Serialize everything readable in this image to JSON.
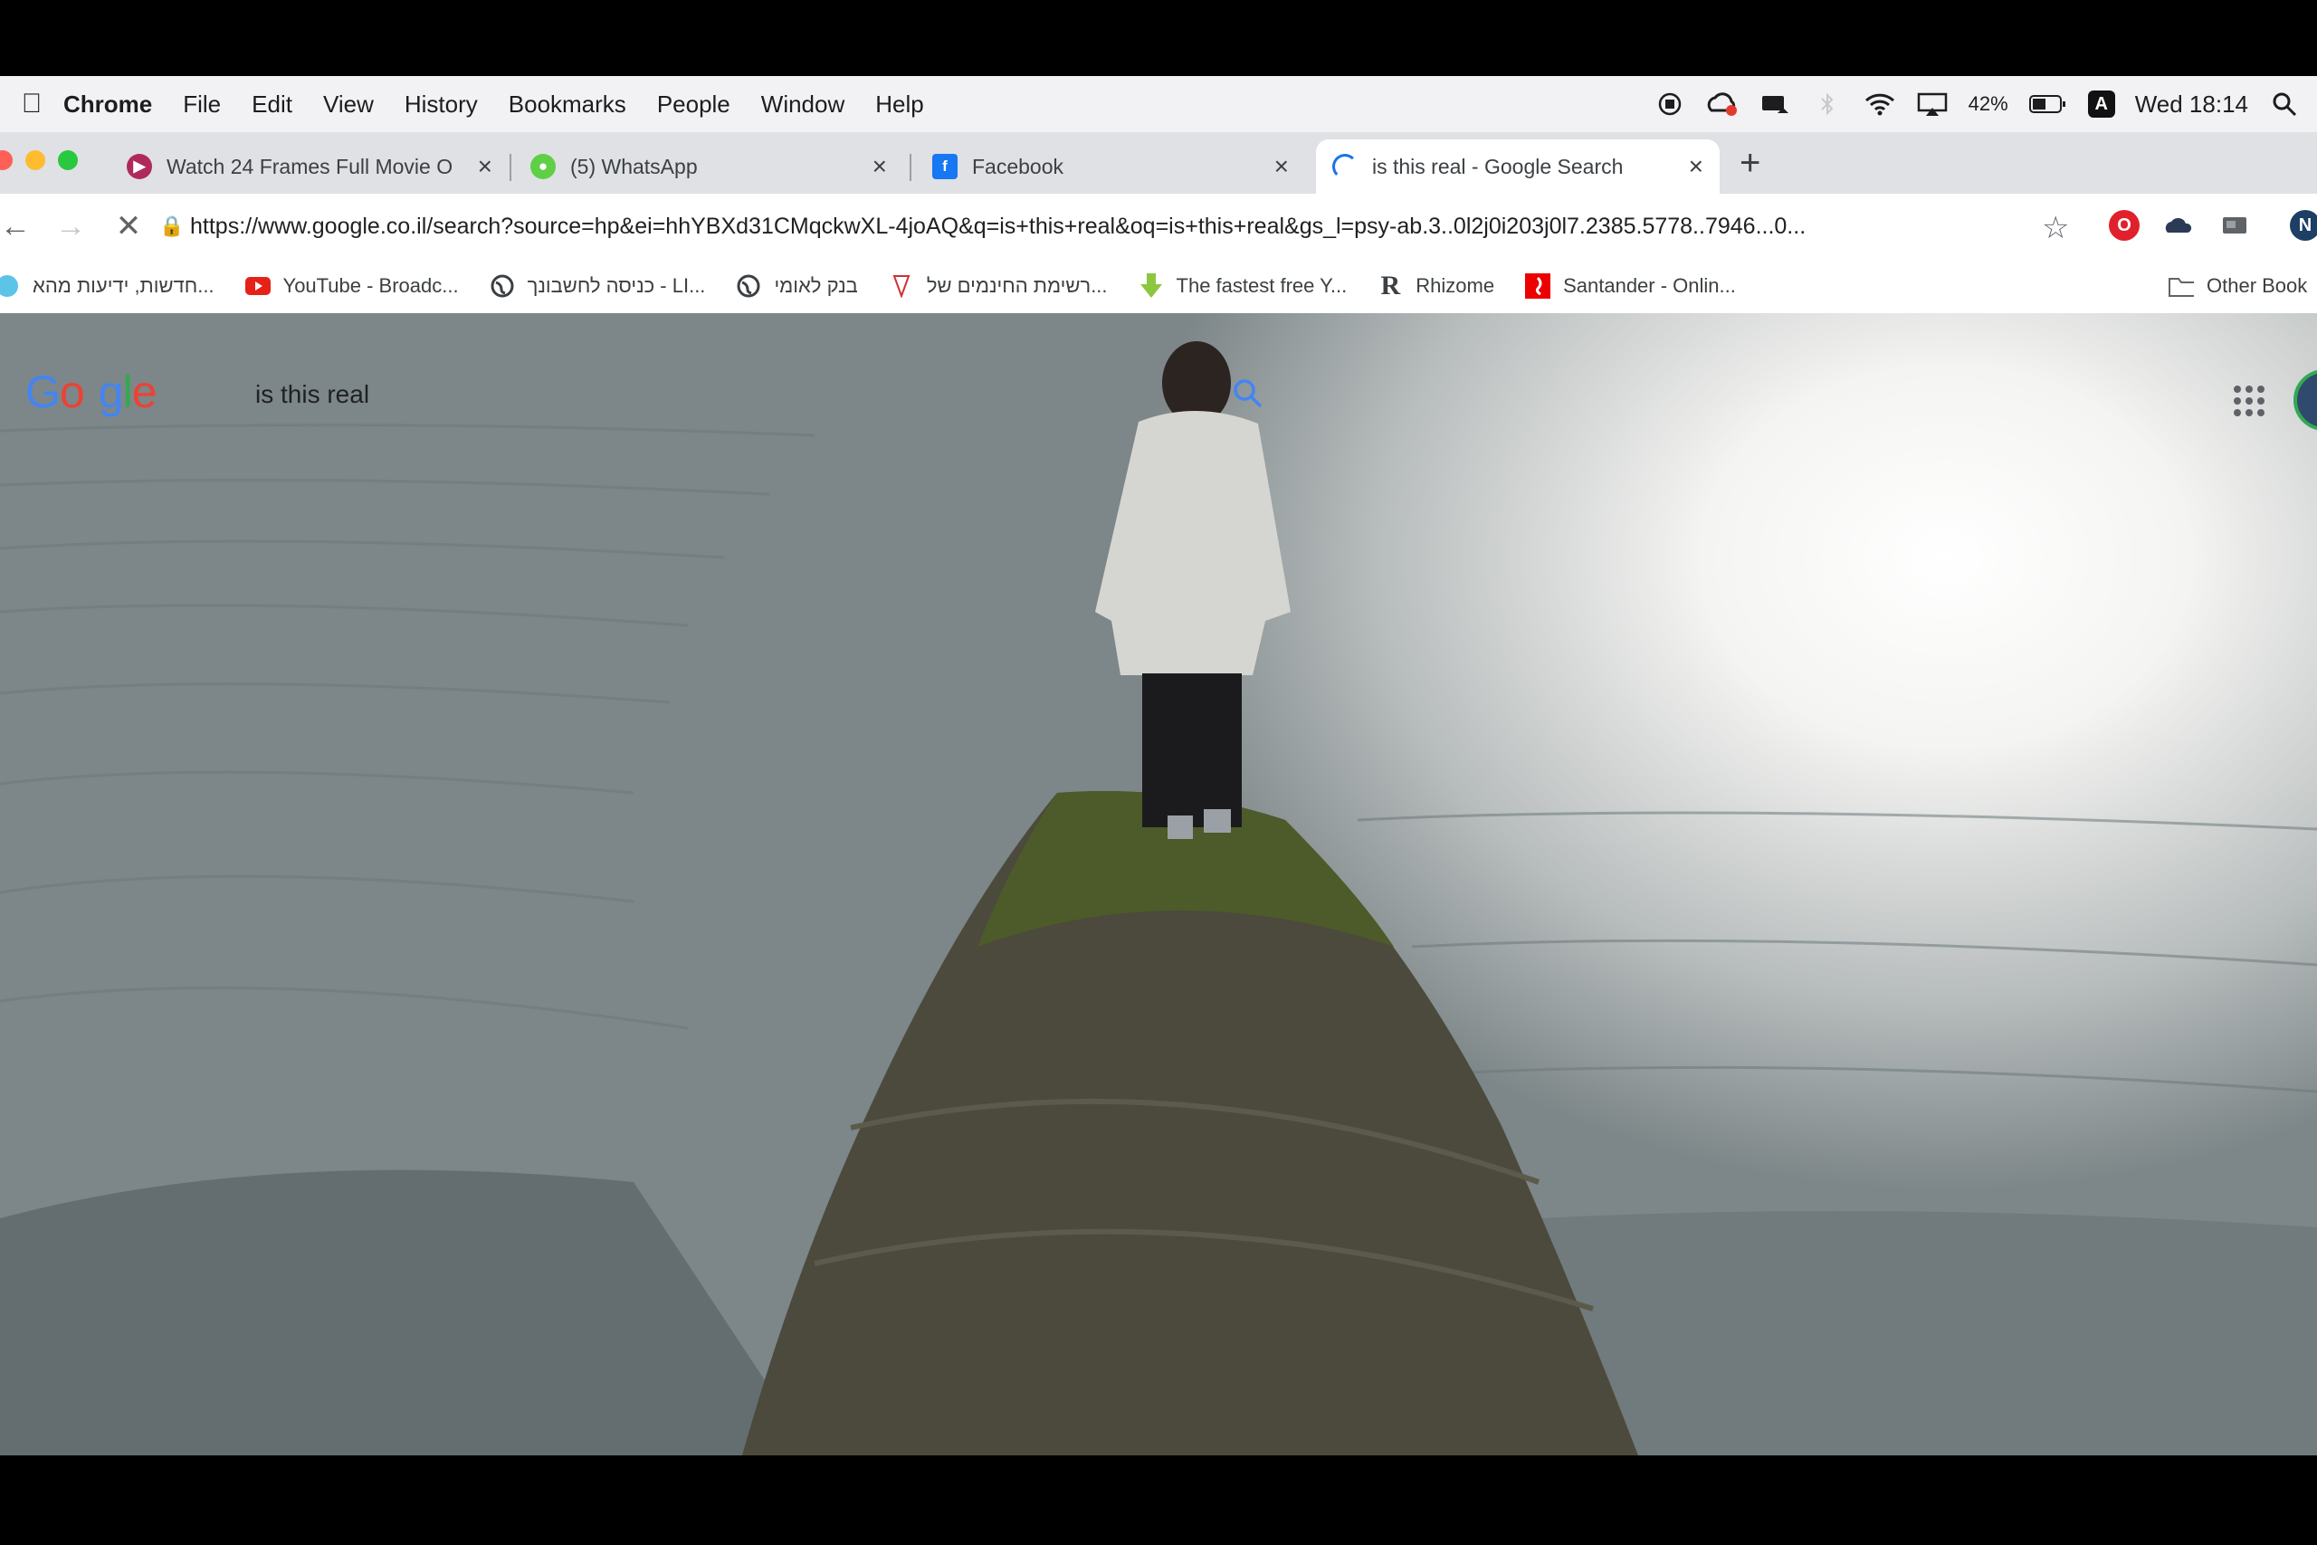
{
  "menubar": {
    "app": "Chrome",
    "items": [
      "File",
      "Edit",
      "View",
      "History",
      "Bookmarks",
      "People",
      "Window",
      "Help"
    ],
    "battery": "42%",
    "input_source": "A",
    "clock": "Wed 18:14"
  },
  "tabs": [
    {
      "title": "Watch 24 Frames Full Movie O",
      "favicon": "play-circle-icon",
      "color": "#b0295c"
    },
    {
      "title": "(5) WhatsApp",
      "favicon": "whatsapp-icon",
      "color": "#5fcf45"
    },
    {
      "title": "Facebook",
      "favicon": "facebook-icon",
      "color": "#1877f2",
      "fav_text": "f"
    },
    {
      "title": "is this real - Google Search",
      "favicon": "loading-spinner-icon",
      "color": "#1a73e8",
      "active": true
    }
  ],
  "toolbar": {
    "url": "https://www.google.co.il/search?source=hp&ei=hhYBXd31CMqckwXL-4joAQ&q=is+this+real&oq=is+this+real&gs_l=psy-ab.3..0l2j0i203j0l7.2385.5778..7946...0...",
    "ext_last": "N"
  },
  "bookmarks": [
    {
      "label": "חדשות, ידיעות מהא...",
      "icon": "news-icon"
    },
    {
      "label": "YouTube - Broadc...",
      "icon": "youtube-icon"
    },
    {
      "label": "כניסה לחשבונך - LI...",
      "icon": "globe-icon"
    },
    {
      "label": "בנק לאומי",
      "icon": "globe-icon"
    },
    {
      "label": "רשימת החינמים של...",
      "icon": "bookmark-icon"
    },
    {
      "label": "The fastest free Y...",
      "icon": "download-arrow-icon"
    },
    {
      "label": "Rhizome",
      "icon": "rhizome-icon",
      "glyph": "R"
    },
    {
      "label": "Santander - Onlin...",
      "icon": "santander-icon"
    }
  ],
  "other_bookmarks": "Other Book",
  "google": {
    "logo": "Google",
    "query": "is this real"
  },
  "colors": {
    "tab_strip": "#dfe1e5",
    "menubar": "#f2f2f4"
  }
}
